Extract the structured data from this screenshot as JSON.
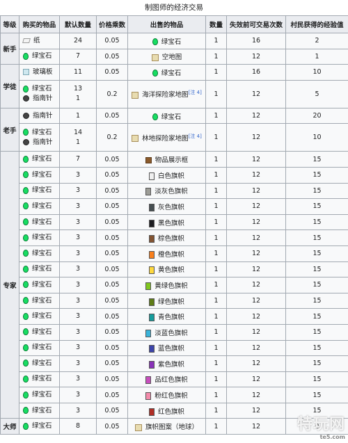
{
  "caption": "制图师的经济交易",
  "headers": [
    "等级",
    "购买的物品",
    "默认数量",
    "价格乘数",
    "出售的物品",
    "数量",
    "失效前可交易次数",
    "村民获得的经验值"
  ],
  "levels": {
    "novice": "新手",
    "apprentice": "学徒",
    "journeyman": "老手",
    "expert": "专家",
    "master": "大师"
  },
  "rows": [
    {
      "buy": [
        {
          "icon": "paper-icon",
          "name": "纸",
          "qty": "24"
        }
      ],
      "mult": "0.05",
      "sell": {
        "icon": "emerald-icon",
        "name": "绿宝石"
      },
      "sqty": "1",
      "uses": "16",
      "xp": "2"
    },
    {
      "buy": [
        {
          "icon": "emerald-icon",
          "name": "绿宝石",
          "qty": "7"
        }
      ],
      "mult": "0.05",
      "sell": {
        "icon": "map-icon",
        "name": "空地图"
      },
      "sqty": "1",
      "uses": "12",
      "xp": "1"
    },
    {
      "buy": [
        {
          "icon": "glass-pane-icon",
          "name": "玻璃板",
          "qty": "11"
        }
      ],
      "mult": "0.05",
      "sell": {
        "icon": "emerald-icon",
        "name": "绿宝石"
      },
      "sqty": "1",
      "uses": "16",
      "xp": "10"
    },
    {
      "buy": [
        {
          "icon": "emerald-icon",
          "name": "绿宝石",
          "qty": "13"
        },
        {
          "icon": "compass-icon",
          "name": "指南针",
          "qty": "1"
        }
      ],
      "mult": "0.2",
      "sell": {
        "icon": "map-icon",
        "name": "海洋探险家地图",
        "note": "[注 4]"
      },
      "sqty": "1",
      "uses": "12",
      "xp": "5"
    },
    {
      "buy": [
        {
          "icon": "compass-icon",
          "name": "指南针",
          "qty": "1"
        }
      ],
      "mult": "0.05",
      "sell": {
        "icon": "emerald-icon",
        "name": "绿宝石"
      },
      "sqty": "1",
      "uses": "12",
      "xp": "20"
    },
    {
      "buy": [
        {
          "icon": "emerald-icon",
          "name": "绿宝石",
          "qty": "14"
        },
        {
          "icon": "compass-icon",
          "name": "指南针",
          "qty": "1"
        }
      ],
      "mult": "0.2",
      "sell": {
        "icon": "map-icon",
        "name": "林地探险家地图",
        "note": "[注 4]"
      },
      "sqty": "1",
      "uses": "12",
      "xp": "10"
    },
    {
      "buy": [
        {
          "icon": "emerald-icon",
          "name": "绿宝石",
          "qty": "7"
        }
      ],
      "mult": "0.05",
      "sell": {
        "icon": "item-frame-icon",
        "name": "物品展示框"
      },
      "sqty": "1",
      "uses": "12",
      "xp": "15"
    },
    {
      "buy": [
        {
          "icon": "emerald-icon",
          "name": "绿宝石",
          "qty": "3"
        }
      ],
      "mult": "0.05",
      "sell": {
        "icon": "white-banner-icon",
        "name": "白色旗帜",
        "color": "#f0f0f0"
      },
      "sqty": "1",
      "uses": "12",
      "xp": "15"
    },
    {
      "buy": [
        {
          "icon": "emerald-icon",
          "name": "绿宝石",
          "qty": "3"
        }
      ],
      "mult": "0.05",
      "sell": {
        "icon": "light-gray-banner-icon",
        "name": "淡灰色旗帜",
        "color": "#9d9d97"
      },
      "sqty": "1",
      "uses": "12",
      "xp": "15"
    },
    {
      "buy": [
        {
          "icon": "emerald-icon",
          "name": "绿宝石",
          "qty": "3"
        }
      ],
      "mult": "0.05",
      "sell": {
        "icon": "gray-banner-icon",
        "name": "灰色旗帜",
        "color": "#474f52"
      },
      "sqty": "1",
      "uses": "12",
      "xp": "15"
    },
    {
      "buy": [
        {
          "icon": "emerald-icon",
          "name": "绿宝石",
          "qty": "3"
        }
      ],
      "mult": "0.05",
      "sell": {
        "icon": "black-banner-icon",
        "name": "黑色旗帜",
        "color": "#1d1d21"
      },
      "sqty": "1",
      "uses": "12",
      "xp": "15"
    },
    {
      "buy": [
        {
          "icon": "emerald-icon",
          "name": "绿宝石",
          "qty": "3"
        }
      ],
      "mult": "0.05",
      "sell": {
        "icon": "brown-banner-icon",
        "name": "棕色旗帜",
        "color": "#835432"
      },
      "sqty": "1",
      "uses": "12",
      "xp": "15"
    },
    {
      "buy": [
        {
          "icon": "emerald-icon",
          "name": "绿宝石",
          "qty": "3"
        }
      ],
      "mult": "0.05",
      "sell": {
        "icon": "orange-banner-icon",
        "name": "橙色旗帜",
        "color": "#f9801d"
      },
      "sqty": "1",
      "uses": "12",
      "xp": "15"
    },
    {
      "buy": [
        {
          "icon": "emerald-icon",
          "name": "绿宝石",
          "qty": "3"
        }
      ],
      "mult": "0.05",
      "sell": {
        "icon": "yellow-banner-icon",
        "name": "黄色旗帜",
        "color": "#fed83d"
      },
      "sqty": "1",
      "uses": "12",
      "xp": "15"
    },
    {
      "buy": [
        {
          "icon": "emerald-icon",
          "name": "绿宝石",
          "qty": "3"
        }
      ],
      "mult": "0.05",
      "sell": {
        "icon": "lime-banner-icon",
        "name": "黄绿色旗帜",
        "color": "#80c71f"
      },
      "sqty": "1",
      "uses": "12",
      "xp": "15"
    },
    {
      "buy": [
        {
          "icon": "emerald-icon",
          "name": "绿宝石",
          "qty": "3"
        }
      ],
      "mult": "0.05",
      "sell": {
        "icon": "green-banner-icon",
        "name": "绿色旗帜",
        "color": "#5e7c16"
      },
      "sqty": "1",
      "uses": "12",
      "xp": "15"
    },
    {
      "buy": [
        {
          "icon": "emerald-icon",
          "name": "绿宝石",
          "qty": "3"
        }
      ],
      "mult": "0.05",
      "sell": {
        "icon": "cyan-banner-icon",
        "name": "青色旗帜",
        "color": "#169c9c"
      },
      "sqty": "1",
      "uses": "12",
      "xp": "15"
    },
    {
      "buy": [
        {
          "icon": "emerald-icon",
          "name": "绿宝石",
          "qty": "3"
        }
      ],
      "mult": "0.05",
      "sell": {
        "icon": "light-blue-banner-icon",
        "name": "淡蓝色旗帜",
        "color": "#3ab3da"
      },
      "sqty": "1",
      "uses": "12",
      "xp": "15"
    },
    {
      "buy": [
        {
          "icon": "emerald-icon",
          "name": "绿宝石",
          "qty": "3"
        }
      ],
      "mult": "0.05",
      "sell": {
        "icon": "blue-banner-icon",
        "name": "蓝色旗帜",
        "color": "#3c44aa"
      },
      "sqty": "1",
      "uses": "12",
      "xp": "15"
    },
    {
      "buy": [
        {
          "icon": "emerald-icon",
          "name": "绿宝石",
          "qty": "3"
        }
      ],
      "mult": "0.05",
      "sell": {
        "icon": "purple-banner-icon",
        "name": "紫色旗帜",
        "color": "#8932b8"
      },
      "sqty": "1",
      "uses": "12",
      "xp": "15"
    },
    {
      "buy": [
        {
          "icon": "emerald-icon",
          "name": "绿宝石",
          "qty": "3"
        }
      ],
      "mult": "0.05",
      "sell": {
        "icon": "magenta-banner-icon",
        "name": "品红色旗帜",
        "color": "#c74ebd"
      },
      "sqty": "1",
      "uses": "12",
      "xp": "15"
    },
    {
      "buy": [
        {
          "icon": "emerald-icon",
          "name": "绿宝石",
          "qty": "3"
        }
      ],
      "mult": "0.05",
      "sell": {
        "icon": "pink-banner-icon",
        "name": "粉红色旗帜",
        "color": "#f38baa"
      },
      "sqty": "1",
      "uses": "12",
      "xp": "15"
    },
    {
      "buy": [
        {
          "icon": "emerald-icon",
          "name": "绿宝石",
          "qty": "3"
        }
      ],
      "mult": "0.05",
      "sell": {
        "icon": "red-banner-icon",
        "name": "红色旗帜",
        "color": "#b02e26"
      },
      "sqty": "1",
      "uses": "12",
      "xp": "15"
    },
    {
      "buy": [
        {
          "icon": "emerald-icon",
          "name": "绿宝石",
          "qty": "8"
        }
      ],
      "mult": "0.05",
      "sell": {
        "icon": "banner-pattern-icon",
        "name": "旗帜图案（地球）"
      },
      "sqty": "1",
      "uses": "12",
      "xp": "0"
    }
  ],
  "watermark": {
    "brand": "特玩网",
    "site": "te5.com"
  }
}
